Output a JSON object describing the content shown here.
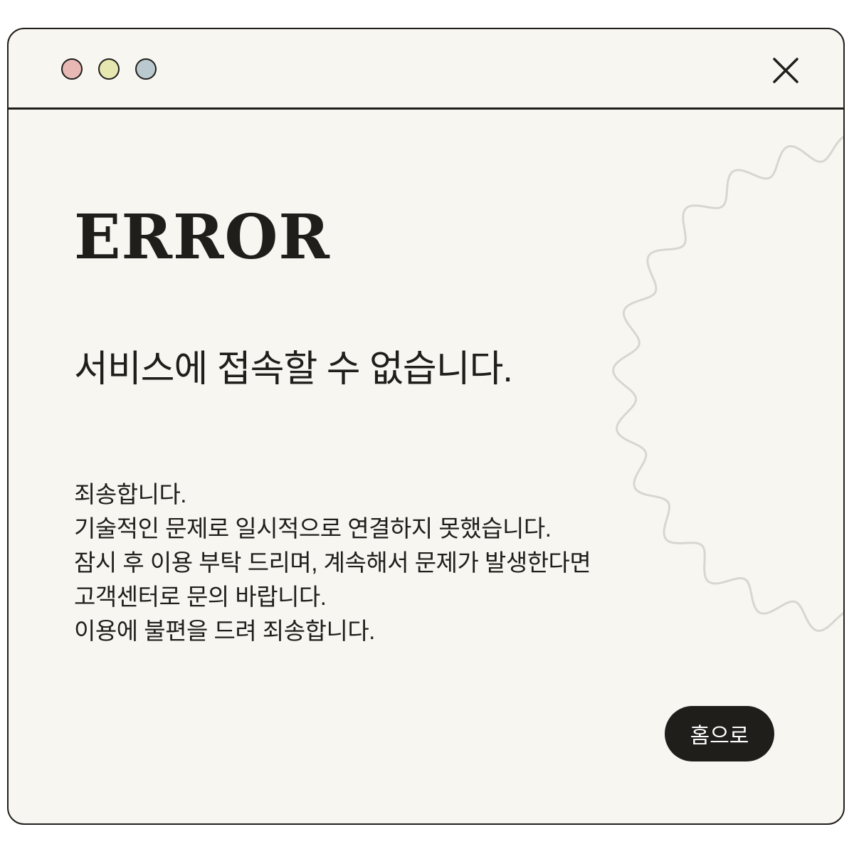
{
  "window": {
    "controls": [
      {
        "name": "red-dot",
        "color": "#e8b8b4"
      },
      {
        "name": "yellow-dot",
        "color": "#e6e6b0"
      },
      {
        "name": "blue-dot",
        "color": "#b9c9cd"
      }
    ],
    "close_icon": "close-icon"
  },
  "content": {
    "title": "ERROR",
    "headline": "서비스에 접속할 수 없습니다.",
    "message_lines": [
      "죄송합니다.",
      "기술적인 문제로 일시적으로 연결하지 못했습니다.",
      "잠시 후 이용 부탁 드리며, 계속해서 문제가 발생한다면",
      "고객센터로 문의 바랍니다.",
      "이용에 불편을 드려 죄송합니다."
    ],
    "home_button_label": "홈으로"
  },
  "colors": {
    "background": "#f8f6f1",
    "ink": "#1f1e1b",
    "wave": "#d8d6d1"
  }
}
